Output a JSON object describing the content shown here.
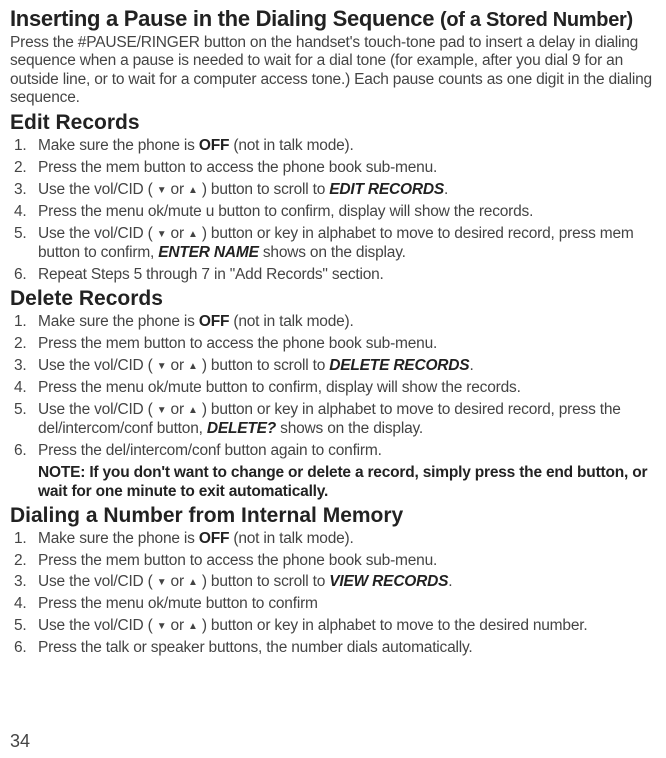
{
  "title_main": "Inserting a Pause in the Dialing Sequence ",
  "title_sub": "(of a Stored Number)",
  "intro": "Press the #PAUSE/RINGER button on the handset's touch-tone pad to insert a delay in dialing sequence when a pause is needed to wait for a dial tone (for example, after you dial 9 for an outside line, or to wait for a computer access tone.) Each pause counts as one digit in the dialing sequence.",
  "sections": {
    "edit": {
      "heading": "Edit Records",
      "steps": [
        {
          "n": "1.",
          "a": "Make sure the phone is ",
          "b": "OFF",
          "c": " (not in talk mode)."
        },
        {
          "n": "2.",
          "a": "Press the mem button to access the phone book sub-menu."
        },
        {
          "n": "3.",
          "a": "Use the vol/CID ( ",
          "arr": true,
          "c": " )  button to scroll to ",
          "d": "EDIT RECORDS",
          "e": "."
        },
        {
          "n": "4.",
          "a": "Press the menu ok/mute u button to confirm, display will show the records."
        },
        {
          "n": "5.",
          "a": "Use the vol/CID ( ",
          "arr": true,
          "c": " )  button or key in alphabet to move to desired record, press mem button to confirm, ",
          "d": "ENTER NAME",
          "e": " shows on the display."
        },
        {
          "n": "6.",
          "a": "Repeat Steps 5 through 7 in \"Add Records\" section."
        }
      ]
    },
    "delete": {
      "heading": "Delete Records",
      "steps": [
        {
          "n": "1.",
          "a": "Make sure the phone is ",
          "b": "OFF",
          "c": " (not in talk mode)."
        },
        {
          "n": "2.",
          "a": "Press the mem button to access the phone book sub-menu."
        },
        {
          "n": "3.",
          "a": "Use the vol/CID ( ",
          "arr": true,
          "c": " )  button to scroll to ",
          "d": "DELETE RECORDS",
          "e": "."
        },
        {
          "n": "4.",
          "a": "Press the menu ok/mute  button to confirm, display will show the records."
        },
        {
          "n": "5.",
          "a": "Use the vol/CID ( ",
          "arr": true,
          "c": " )  button or key in alphabet to move to desired record, press the del/intercom/conf button, ",
          "d": "DELETE?",
          "e": " shows on the display."
        },
        {
          "n": "6.",
          "a": "Press the del/intercom/conf button again to confirm."
        }
      ],
      "note_label": "NOTE: ",
      "note_body": "If you don't want to change or delete a record, simply press the end button, or wait for one minute to exit automatically."
    },
    "dial": {
      "heading": "Dialing a Number from Internal Memory",
      "steps": [
        {
          "n": "1.",
          "a": "Make sure the phone is ",
          "b": "OFF",
          "c": " (not in talk mode)."
        },
        {
          "n": "2.",
          "a": "Press the mem button to access the phone book sub-menu."
        },
        {
          "n": "3.",
          "a": "Use the vol/CID ( ",
          "arr": true,
          "c": " )  button to scroll to  ",
          "d": "VIEW RECORDS",
          "e": "."
        },
        {
          "n": "4.",
          "a": "Press the menu ok/mute  button to confirm"
        },
        {
          "n": "5.",
          "a": "Use the vol/CID ( ",
          "arr": true,
          "c": " )  button or key in alphabet to move to the desired number."
        },
        {
          "n": "6.",
          "a": "Press the talk or speaker buttons, the number dials automatically."
        }
      ]
    }
  },
  "arrow_down": "▼",
  "arrow_or": " or ",
  "arrow_up": "▲",
  "page_number": "34"
}
